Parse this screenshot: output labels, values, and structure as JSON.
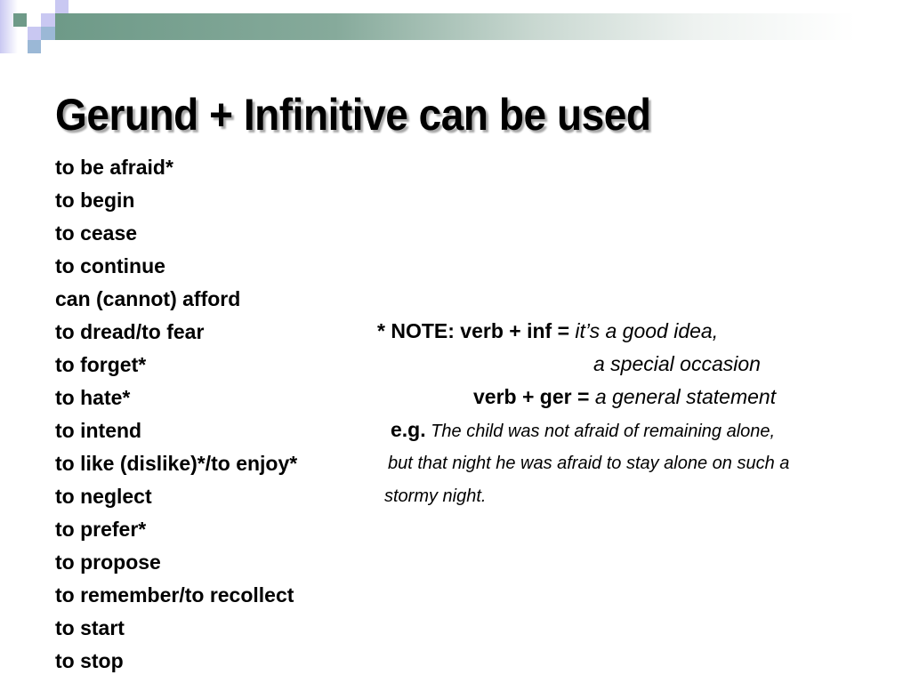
{
  "slide": {
    "title": "Gerund + Infinitive can be used",
    "colors": {
      "header_bar": "#6e9a88",
      "square_green": "#6e9a88",
      "square_lavender": "#c9c8f2",
      "square_blue": "#9bb8d6"
    },
    "verbs": [
      "to be afraid*",
      "to begin",
      "to cease",
      "to continue",
      "can (cannot) afford",
      "to dread/to fear",
      "to forget*",
      "to hate*",
      "to intend",
      "to like (dislike)*/to enjoy*",
      "to neglect",
      "to prefer*",
      "to propose",
      "to remember/to recollect",
      "to start",
      "to stop"
    ],
    "note": {
      "line1_label": "* NOTE: verb + inf = ",
      "line1_meaning": "it’s a good idea,",
      "line2_meaning": "a special occasion",
      "line3_label": "verb + ger = ",
      "line3_meaning": "a general statement"
    },
    "example": {
      "prefix": "e.g.",
      "line1": "The child was not afraid of remaining alone,",
      "line2": "but that night he was afraid to stay alone on such a",
      "line3": "stormy night."
    }
  }
}
